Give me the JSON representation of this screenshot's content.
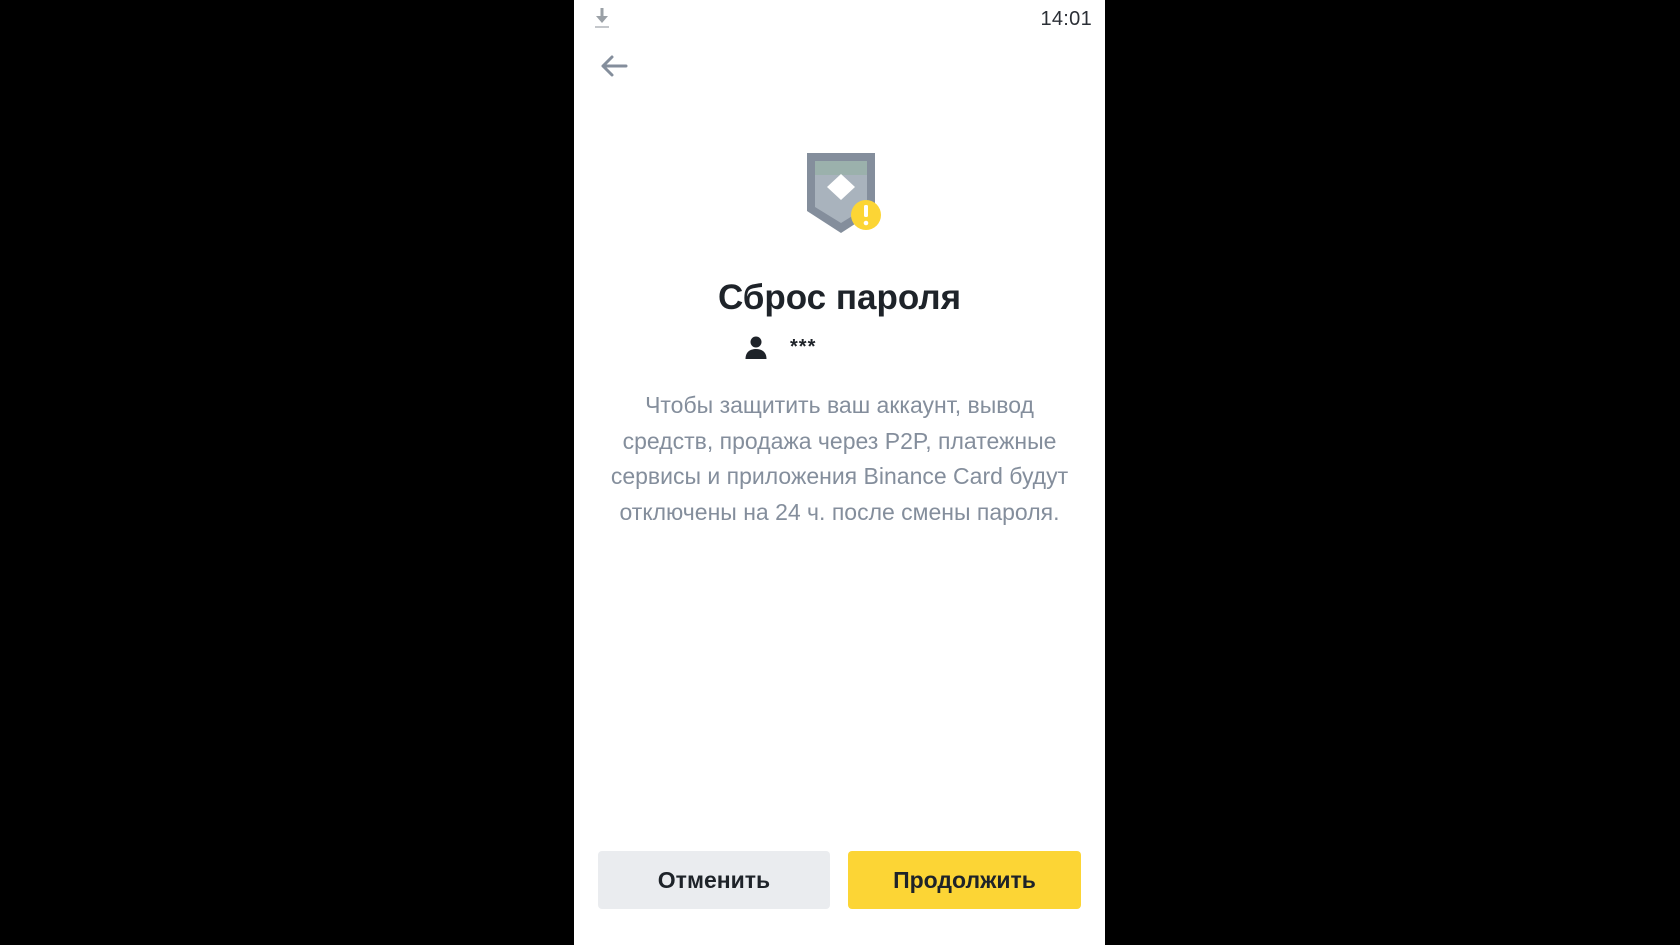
{
  "status_bar": {
    "time": "14:01",
    "notification_icon": "download-icon"
  },
  "header": {
    "back_icon": "back-arrow-icon"
  },
  "main": {
    "illustration_icon": "shield-warning-icon",
    "title": "Сброс пароля",
    "account": {
      "icon": "user-icon",
      "name": "***"
    },
    "description": "Чтобы защитить ваш аккаунт, вывод средств, продажа через P2P, платежные сервисы и приложения Binance Card будут отключены на 24 ч. после смены пароля."
  },
  "footer": {
    "cancel_label": "Отменить",
    "continue_label": "Продолжить"
  },
  "colors": {
    "accent": "#FCD535",
    "cancel_background": "#EAECEF",
    "title_text": "#1E2329",
    "secondary_text": "#848E9C",
    "icon_gray": "#848E9C"
  }
}
